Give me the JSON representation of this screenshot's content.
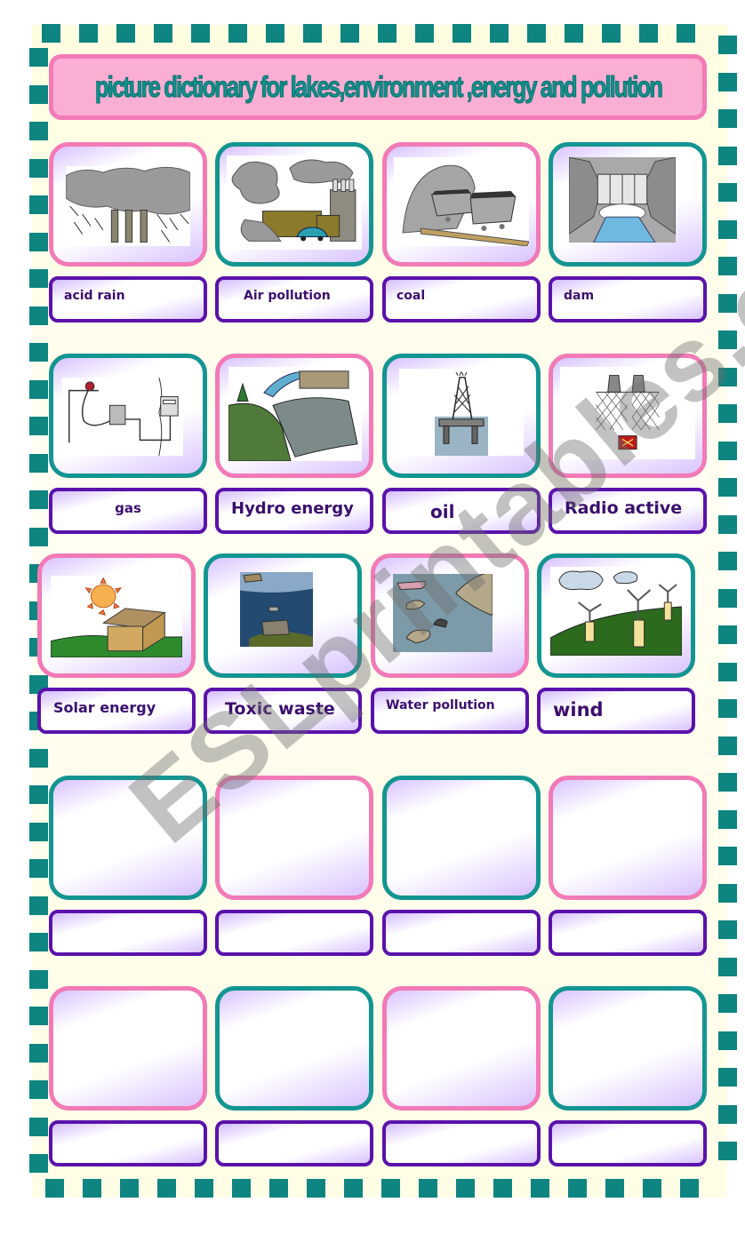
{
  "title": "picture dictionary for lakes,environment ,energy and pollution",
  "watermark": "ESLprintables.com",
  "colors": {
    "dash": "#0e8580",
    "title_fill": "#fbaed3",
    "title_border": "#f27ab6",
    "title_text": "#10918d",
    "card_pink": "#f27ab6",
    "card_teal": "#139591",
    "label_border": "#5a12ab",
    "label_text": "#3b0e6e"
  },
  "rows": [
    {
      "cards": [
        {
          "picture": "acid-rain-picture",
          "frame": "pink",
          "label": "acid rain"
        },
        {
          "picture": "air-pollution-picture",
          "frame": "teal",
          "label": "Air pollution"
        },
        {
          "picture": "coal-picture",
          "frame": "pink",
          "label": "coal"
        },
        {
          "picture": "dam-picture",
          "frame": "teal",
          "label": "dam"
        }
      ]
    },
    {
      "cards": [
        {
          "picture": "gas-picture",
          "frame": "teal",
          "label": "gas"
        },
        {
          "picture": "hydro-energy-picture",
          "frame": "pink",
          "label": "Hydro energy"
        },
        {
          "picture": "oil-picture",
          "frame": "teal",
          "label": "oil"
        },
        {
          "picture": "radio-active-picture",
          "frame": "pink",
          "label": "Radio active"
        }
      ]
    },
    {
      "cards": [
        {
          "picture": "solar-energy-picture",
          "frame": "pink",
          "label": "Solar energy"
        },
        {
          "picture": "toxic-waste-picture",
          "frame": "teal",
          "label": "Toxic waste"
        },
        {
          "picture": "water-pollution-picture",
          "frame": "pink",
          "label": "Water pollution"
        },
        {
          "picture": "wind-picture",
          "frame": "teal",
          "label": "wind"
        }
      ]
    },
    {
      "cards": [
        {
          "picture": "",
          "frame": "teal",
          "label": ""
        },
        {
          "picture": "",
          "frame": "pink",
          "label": ""
        },
        {
          "picture": "",
          "frame": "teal",
          "label": ""
        },
        {
          "picture": "",
          "frame": "pink",
          "label": ""
        }
      ]
    },
    {
      "cards": [
        {
          "picture": "",
          "frame": "pink",
          "label": ""
        },
        {
          "picture": "",
          "frame": "teal",
          "label": ""
        },
        {
          "picture": "",
          "frame": "pink",
          "label": ""
        },
        {
          "picture": "",
          "frame": "teal",
          "label": ""
        }
      ]
    }
  ]
}
